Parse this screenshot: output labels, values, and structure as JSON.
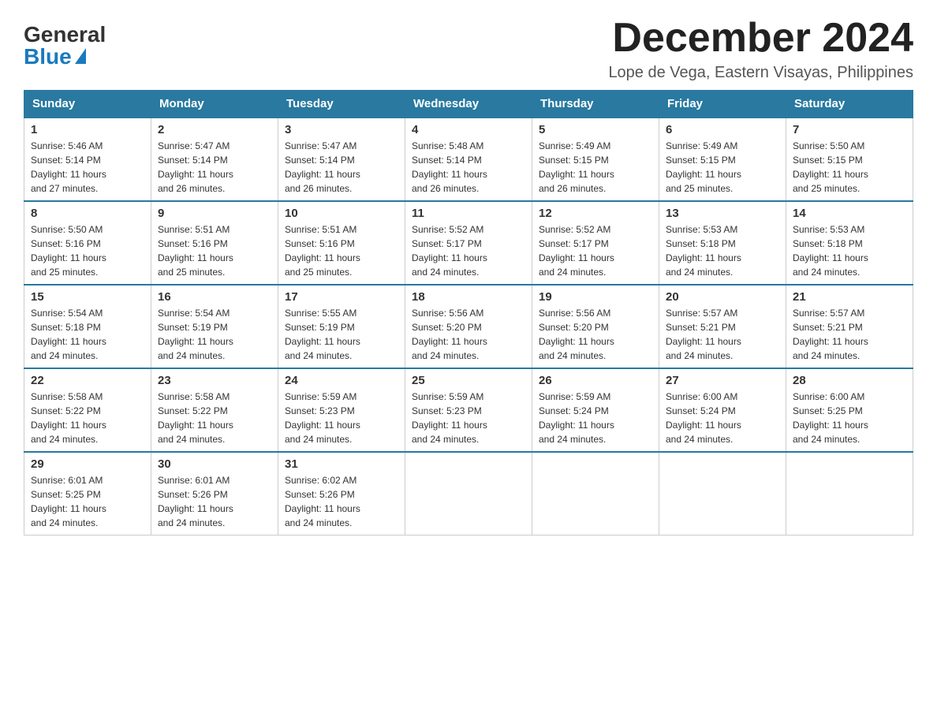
{
  "logo": {
    "general": "General",
    "blue": "Blue"
  },
  "title": "December 2024",
  "location": "Lope de Vega, Eastern Visayas, Philippines",
  "days_of_week": [
    "Sunday",
    "Monday",
    "Tuesday",
    "Wednesday",
    "Thursday",
    "Friday",
    "Saturday"
  ],
  "weeks": [
    [
      {
        "day": "1",
        "info": "Sunrise: 5:46 AM\nSunset: 5:14 PM\nDaylight: 11 hours\nand 27 minutes."
      },
      {
        "day": "2",
        "info": "Sunrise: 5:47 AM\nSunset: 5:14 PM\nDaylight: 11 hours\nand 26 minutes."
      },
      {
        "day": "3",
        "info": "Sunrise: 5:47 AM\nSunset: 5:14 PM\nDaylight: 11 hours\nand 26 minutes."
      },
      {
        "day": "4",
        "info": "Sunrise: 5:48 AM\nSunset: 5:14 PM\nDaylight: 11 hours\nand 26 minutes."
      },
      {
        "day": "5",
        "info": "Sunrise: 5:49 AM\nSunset: 5:15 PM\nDaylight: 11 hours\nand 26 minutes."
      },
      {
        "day": "6",
        "info": "Sunrise: 5:49 AM\nSunset: 5:15 PM\nDaylight: 11 hours\nand 25 minutes."
      },
      {
        "day": "7",
        "info": "Sunrise: 5:50 AM\nSunset: 5:15 PM\nDaylight: 11 hours\nand 25 minutes."
      }
    ],
    [
      {
        "day": "8",
        "info": "Sunrise: 5:50 AM\nSunset: 5:16 PM\nDaylight: 11 hours\nand 25 minutes."
      },
      {
        "day": "9",
        "info": "Sunrise: 5:51 AM\nSunset: 5:16 PM\nDaylight: 11 hours\nand 25 minutes."
      },
      {
        "day": "10",
        "info": "Sunrise: 5:51 AM\nSunset: 5:16 PM\nDaylight: 11 hours\nand 25 minutes."
      },
      {
        "day": "11",
        "info": "Sunrise: 5:52 AM\nSunset: 5:17 PM\nDaylight: 11 hours\nand 24 minutes."
      },
      {
        "day": "12",
        "info": "Sunrise: 5:52 AM\nSunset: 5:17 PM\nDaylight: 11 hours\nand 24 minutes."
      },
      {
        "day": "13",
        "info": "Sunrise: 5:53 AM\nSunset: 5:18 PM\nDaylight: 11 hours\nand 24 minutes."
      },
      {
        "day": "14",
        "info": "Sunrise: 5:53 AM\nSunset: 5:18 PM\nDaylight: 11 hours\nand 24 minutes."
      }
    ],
    [
      {
        "day": "15",
        "info": "Sunrise: 5:54 AM\nSunset: 5:18 PM\nDaylight: 11 hours\nand 24 minutes."
      },
      {
        "day": "16",
        "info": "Sunrise: 5:54 AM\nSunset: 5:19 PM\nDaylight: 11 hours\nand 24 minutes."
      },
      {
        "day": "17",
        "info": "Sunrise: 5:55 AM\nSunset: 5:19 PM\nDaylight: 11 hours\nand 24 minutes."
      },
      {
        "day": "18",
        "info": "Sunrise: 5:56 AM\nSunset: 5:20 PM\nDaylight: 11 hours\nand 24 minutes."
      },
      {
        "day": "19",
        "info": "Sunrise: 5:56 AM\nSunset: 5:20 PM\nDaylight: 11 hours\nand 24 minutes."
      },
      {
        "day": "20",
        "info": "Sunrise: 5:57 AM\nSunset: 5:21 PM\nDaylight: 11 hours\nand 24 minutes."
      },
      {
        "day": "21",
        "info": "Sunrise: 5:57 AM\nSunset: 5:21 PM\nDaylight: 11 hours\nand 24 minutes."
      }
    ],
    [
      {
        "day": "22",
        "info": "Sunrise: 5:58 AM\nSunset: 5:22 PM\nDaylight: 11 hours\nand 24 minutes."
      },
      {
        "day": "23",
        "info": "Sunrise: 5:58 AM\nSunset: 5:22 PM\nDaylight: 11 hours\nand 24 minutes."
      },
      {
        "day": "24",
        "info": "Sunrise: 5:59 AM\nSunset: 5:23 PM\nDaylight: 11 hours\nand 24 minutes."
      },
      {
        "day": "25",
        "info": "Sunrise: 5:59 AM\nSunset: 5:23 PM\nDaylight: 11 hours\nand 24 minutes."
      },
      {
        "day": "26",
        "info": "Sunrise: 5:59 AM\nSunset: 5:24 PM\nDaylight: 11 hours\nand 24 minutes."
      },
      {
        "day": "27",
        "info": "Sunrise: 6:00 AM\nSunset: 5:24 PM\nDaylight: 11 hours\nand 24 minutes."
      },
      {
        "day": "28",
        "info": "Sunrise: 6:00 AM\nSunset: 5:25 PM\nDaylight: 11 hours\nand 24 minutes."
      }
    ],
    [
      {
        "day": "29",
        "info": "Sunrise: 6:01 AM\nSunset: 5:25 PM\nDaylight: 11 hours\nand 24 minutes."
      },
      {
        "day": "30",
        "info": "Sunrise: 6:01 AM\nSunset: 5:26 PM\nDaylight: 11 hours\nand 24 minutes."
      },
      {
        "day": "31",
        "info": "Sunrise: 6:02 AM\nSunset: 5:26 PM\nDaylight: 11 hours\nand 24 minutes."
      },
      {
        "day": "",
        "info": ""
      },
      {
        "day": "",
        "info": ""
      },
      {
        "day": "",
        "info": ""
      },
      {
        "day": "",
        "info": ""
      }
    ]
  ]
}
